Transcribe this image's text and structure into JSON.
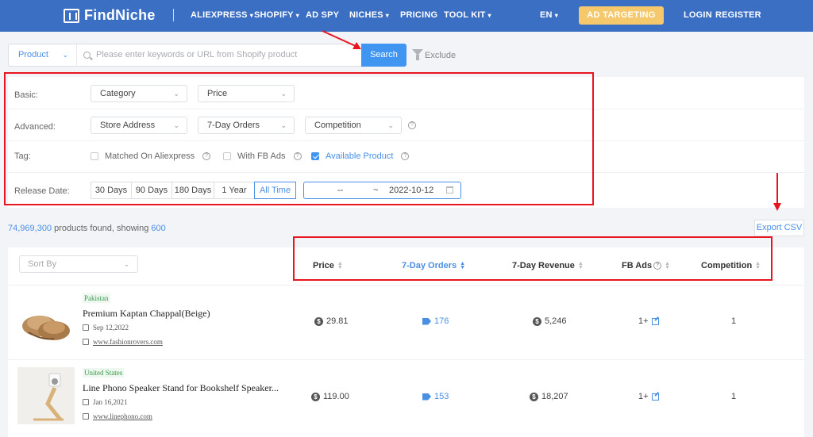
{
  "nav": {
    "brand": "FindNiche",
    "items": [
      {
        "label": "ALIEXPRESS",
        "caret": true
      },
      {
        "label": "SHOPIFY",
        "caret": true
      },
      {
        "label": "AD SPY",
        "caret": false
      },
      {
        "label": "NICHES",
        "caret": true
      },
      {
        "label": "PRICING",
        "caret": false
      },
      {
        "label": "TOOL KIT",
        "caret": true
      },
      {
        "label": "EN",
        "caret": true
      }
    ],
    "ad_targeting": "AD TARGETING",
    "login": "LOGIN",
    "register": "REGISTER"
  },
  "search": {
    "type_value": "Product",
    "placeholder": "Please enter keywords or URL from Shopify product",
    "button": "Search",
    "exclude": "Exclude"
  },
  "filters": {
    "basic_label": "Basic:",
    "basic": [
      "Category",
      "Price"
    ],
    "advanced_label": "Advanced:",
    "advanced": [
      "Store Address",
      "7-Day Orders",
      "Competition"
    ],
    "tag_label": "Tag:",
    "tags": [
      {
        "label": "Matched On Aliexpress",
        "checked": false
      },
      {
        "label": "With FB Ads",
        "checked": false
      },
      {
        "label": "Available Product",
        "checked": true
      }
    ],
    "release_label": "Release Date:",
    "ranges": [
      "30 Days",
      "90 Days",
      "180 Days",
      "1 Year",
      "All Time"
    ],
    "active_range": "All Time",
    "date_from": "--",
    "date_sep": "~",
    "date_to": "2022-10-12"
  },
  "results": {
    "count": "74,969,300",
    "middle": " products found, showing ",
    "showing": "600",
    "export": "Export CSV"
  },
  "table": {
    "sort_placeholder": "Sort By",
    "columns": [
      "Price",
      "7-Day Orders",
      "7-Day Revenue",
      "FB Ads",
      "Competition"
    ],
    "active_column": "7-Day Orders",
    "rows": [
      {
        "country": "Pakistan",
        "title": "Premium Kaptan Chappal(Beige)",
        "date": "Sep 12,2022",
        "url": "www.fashionrovers.com",
        "price": "29.81",
        "orders": "176",
        "revenue": "5,246",
        "fb_ads": "1+",
        "competition": "1"
      },
      {
        "country": "United States",
        "title": "Line Phono Speaker Stand for Bookshelf Speaker...",
        "date": "Jan 16,2021",
        "url": "www.linephono.com",
        "price": "119.00",
        "orders": "153",
        "revenue": "18,207",
        "fb_ads": "1+",
        "competition": "1"
      }
    ]
  },
  "colors": {
    "nav_bg": "#3a6fc4",
    "accent": "#3f95f0",
    "ad_button": "#f5c96b",
    "annotation": "#e8151f",
    "country_tag": "#3a9b4e"
  }
}
